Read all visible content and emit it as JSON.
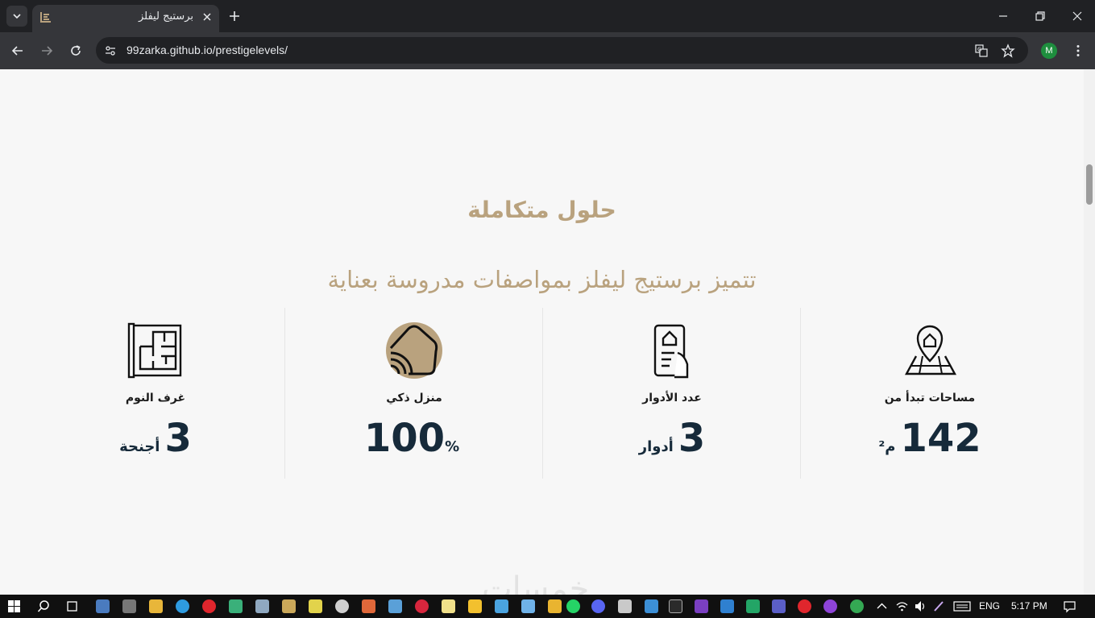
{
  "browser": {
    "tab_title": "برستيج ليفلز",
    "url": "99zarka.github.io/prestigelevels/",
    "profile_initial": "M"
  },
  "section": {
    "title": "حلول متكاملة",
    "subtitle": "تتميز برستيج ليفلز بمواصفات مدروسة بعناية"
  },
  "features": [
    {
      "icon": "blueprint-icon",
      "label": "غرف النوم",
      "value": "3",
      "unit": "أجنحة"
    },
    {
      "icon": "smart-home-icon",
      "label": "منزل ذكي",
      "value": "100",
      "unit": "%"
    },
    {
      "icon": "phone-house-icon",
      "label": "عدد الأدوار",
      "value": "3",
      "unit": "أدوار"
    },
    {
      "icon": "map-pin-house-icon",
      "label": "مساحات تبدأ من",
      "value": "142",
      "unit": "م²"
    }
  ],
  "watermark": "خمسات",
  "taskbar": {
    "language": "ENG",
    "time": "5:17 PM"
  },
  "colors": {
    "accent": "#b9a27e",
    "value_text": "#162a3a",
    "chrome_dark": "#202124",
    "chrome_mid": "#35363a"
  }
}
